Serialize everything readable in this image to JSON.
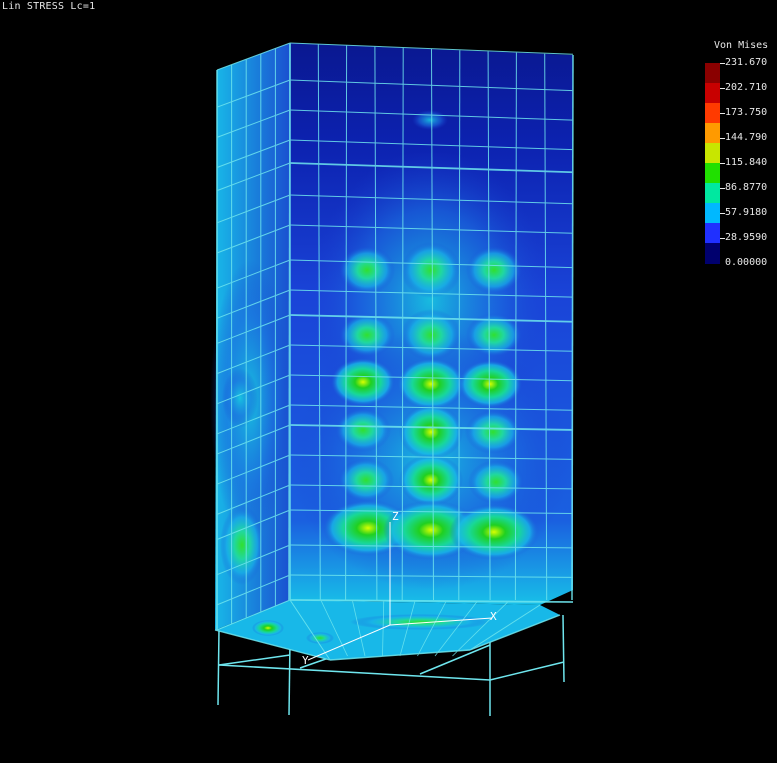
{
  "header": {
    "title": "Lin STRESS Lc=1"
  },
  "legend": {
    "title": "Von Mises",
    "labels": [
      "231.670",
      "202.710",
      "173.750",
      "144.790",
      "115.840",
      "86.8770",
      "57.9180",
      "28.9590",
      "0.00000"
    ],
    "colors": [
      "#8a0000",
      "#c80000",
      "#ff3a00",
      "#ff9a00",
      "#c8e600",
      "#20e000",
      "#00e8a0",
      "#00b8ff",
      "#2030ff",
      "#00006e"
    ]
  },
  "axes": {
    "x": "X",
    "y": "Y",
    "z": "Z"
  },
  "colors": {
    "mesh": "#6fe6ee",
    "low_stress": "#0a1ea8",
    "mid_stress": "#2ad6c8",
    "high_stress": "#20d020"
  }
}
